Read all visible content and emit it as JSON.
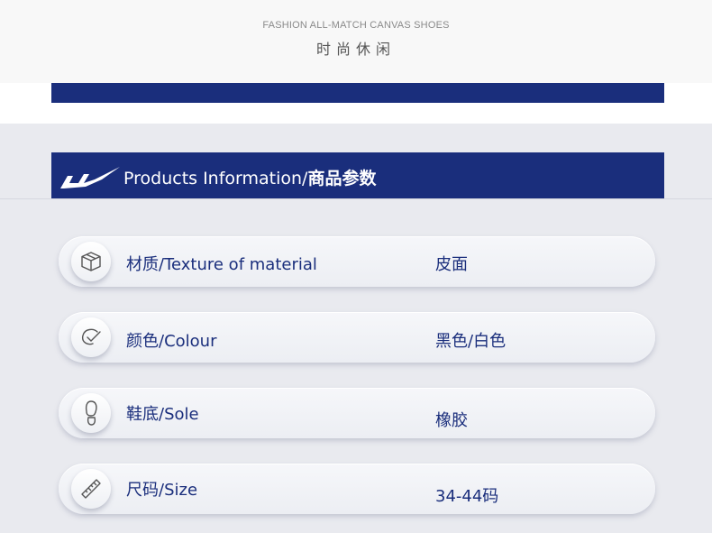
{
  "header": {
    "subtitle": "FASHION ALL-MATCH CANVAS SHOES",
    "title": "时尚休闲"
  },
  "section": {
    "title_en": "Products Information/",
    "title_cn": "商品参数"
  },
  "specs": [
    {
      "icon": "box-icon",
      "label": "材质/Texture of material",
      "value": "皮面"
    },
    {
      "icon": "color-swatch-icon",
      "label": "颜色/Colour",
      "value": "黑色/白色"
    },
    {
      "icon": "shoe-sole-icon",
      "label": "鞋底/Sole",
      "value": "橡胶"
    },
    {
      "icon": "ruler-icon",
      "label": "尺码/Size",
      "value": "34-44码"
    }
  ],
  "colors": {
    "brand_navy": "#1a2e7c",
    "background": "#e9eaef"
  }
}
